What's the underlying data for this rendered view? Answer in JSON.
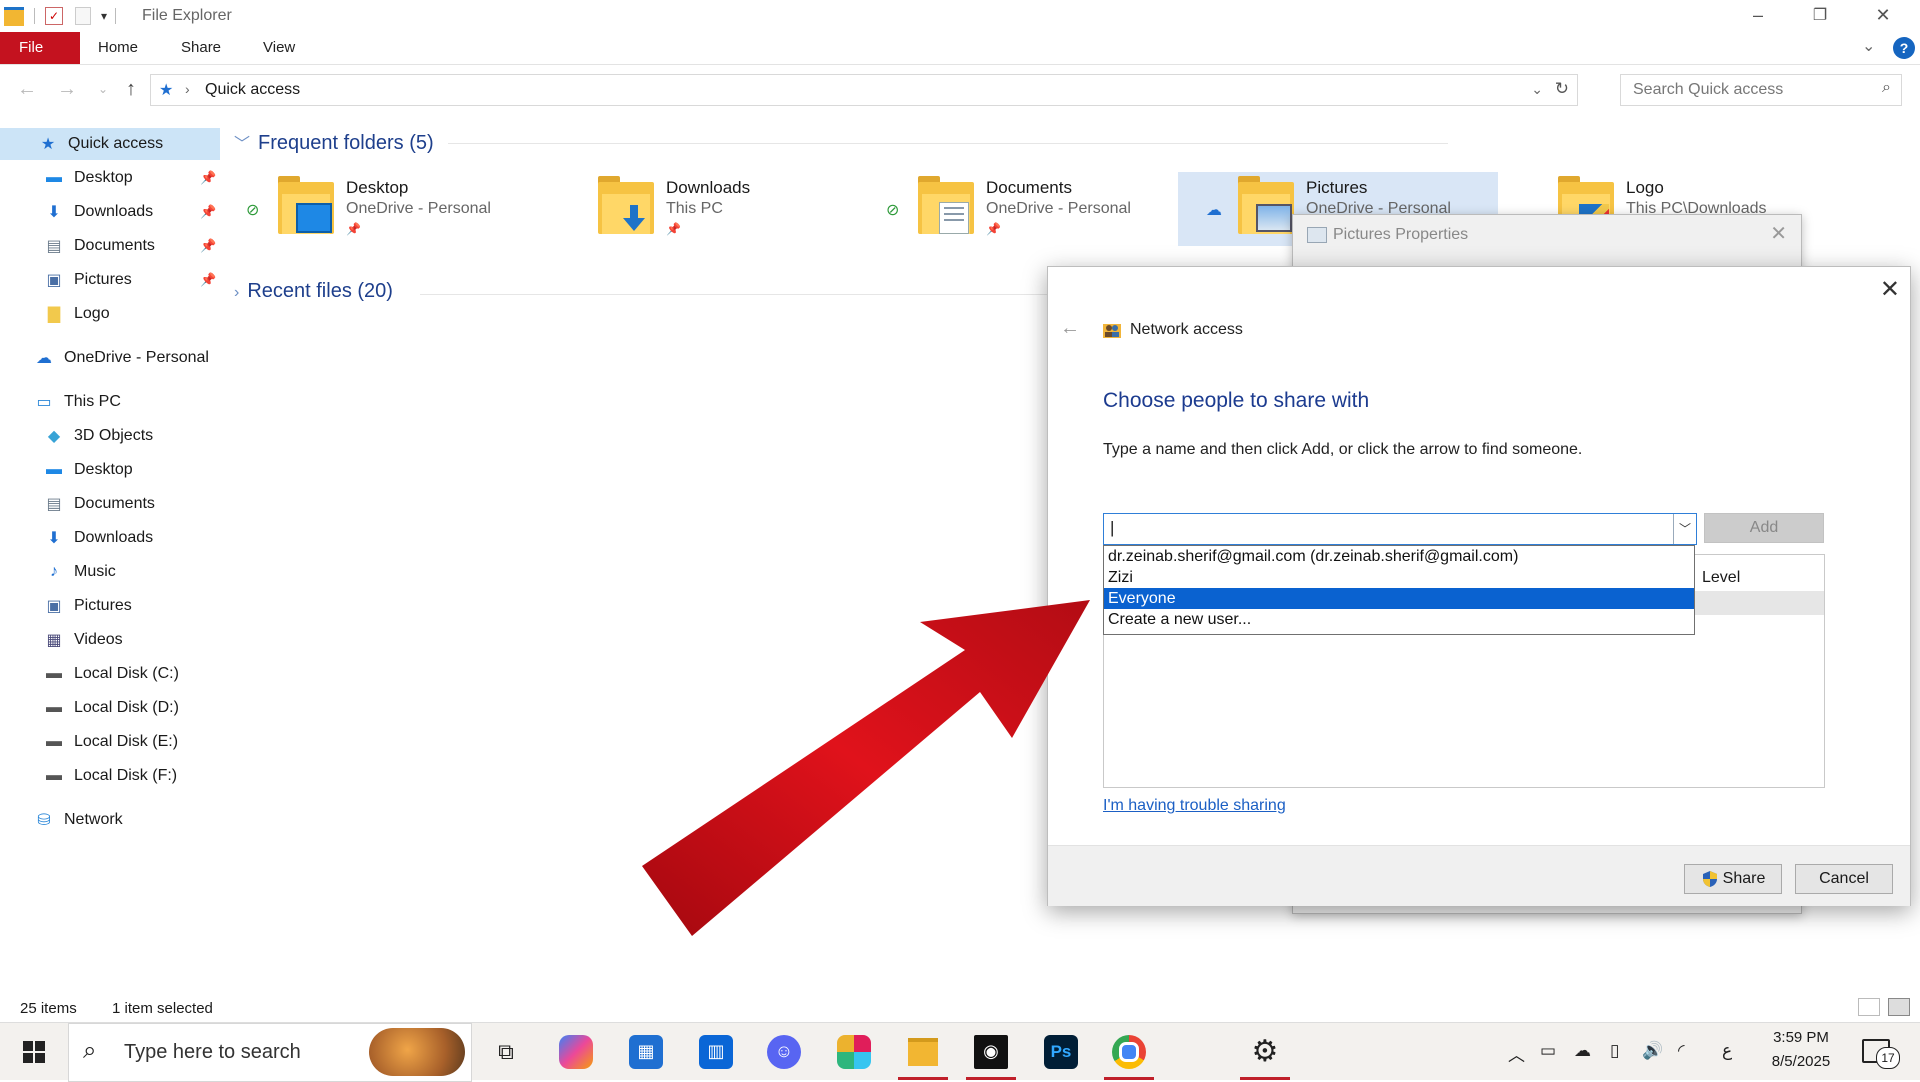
{
  "window": {
    "title": "File Explorer",
    "minimize": "–",
    "restore": "❐",
    "close": "✕"
  },
  "ribbon": {
    "tabs": [
      "File",
      "Home",
      "Share",
      "View"
    ],
    "expand": "⌄",
    "help": "?"
  },
  "address": {
    "path": "Quick access",
    "search_placeholder": "Search Quick access"
  },
  "sidebar": {
    "items": [
      {
        "label": "Quick access",
        "icon": "star-icon",
        "pinned": false
      },
      {
        "label": "Desktop",
        "icon": "desktop-icon",
        "pinned": true
      },
      {
        "label": "Downloads",
        "icon": "download-icon",
        "pinned": true
      },
      {
        "label": "Documents",
        "icon": "document-icon",
        "pinned": true
      },
      {
        "label": "Pictures",
        "icon": "pictures-icon",
        "pinned": true
      },
      {
        "label": "Logo",
        "icon": "folder-icon",
        "pinned": false
      },
      {
        "label": "OneDrive - Personal",
        "icon": "cloud-icon",
        "pinned": false
      },
      {
        "label": "This PC",
        "icon": "computer-icon",
        "pinned": false
      },
      {
        "label": "3D Objects",
        "icon": "cube-icon",
        "pinned": false
      },
      {
        "label": "Desktop",
        "icon": "desktop-icon",
        "pinned": false
      },
      {
        "label": "Documents",
        "icon": "document-icon",
        "pinned": false
      },
      {
        "label": "Downloads",
        "icon": "download-icon",
        "pinned": false
      },
      {
        "label": "Music",
        "icon": "music-icon",
        "pinned": false
      },
      {
        "label": "Pictures",
        "icon": "pictures-icon",
        "pinned": false
      },
      {
        "label": "Videos",
        "icon": "video-icon",
        "pinned": false
      },
      {
        "label": "Local Disk (C:)",
        "icon": "disk-icon",
        "pinned": false
      },
      {
        "label": "Local Disk (D:)",
        "icon": "disk-icon",
        "pinned": false
      },
      {
        "label": "Local Disk (E:)",
        "icon": "disk-icon",
        "pinned": false
      },
      {
        "label": "Local Disk (F:)",
        "icon": "disk-icon",
        "pinned": false
      },
      {
        "label": "Network",
        "icon": "network-icon",
        "pinned": false
      }
    ]
  },
  "content": {
    "frequent_header": "Frequent folders (5)",
    "recent_header": "Recent files (20)",
    "folders": [
      {
        "name": "Desktop",
        "location": "OneDrive - Personal",
        "status": "synced"
      },
      {
        "name": "Downloads",
        "location": "This PC",
        "status": "none"
      },
      {
        "name": "Documents",
        "location": "OneDrive - Personal",
        "status": "synced"
      },
      {
        "name": "Pictures",
        "location": "OneDrive - Personal",
        "status": "cloud"
      },
      {
        "name": "Logo",
        "location": "This PC\\Downloads",
        "status": "none"
      }
    ]
  },
  "properties_dialog": {
    "title": "Pictures Properties"
  },
  "share_dialog": {
    "header": "Network access",
    "heading": "Choose people to share with",
    "instruction": "Type a name and then click Add, or click the arrow to find someone.",
    "input_value": "",
    "add_label": "Add",
    "permission_header": "Level",
    "options": [
      "dr.zeinab.sherif@gmail.com (dr.zeinab.sherif@gmail.com)",
      "Zizi",
      "Everyone",
      "Create a new user..."
    ],
    "selected_option": "Everyone",
    "trouble_link": "I'm having trouble sharing",
    "share_label": "Share",
    "cancel_label": "Cancel"
  },
  "statusbar": {
    "items_count": "25 items",
    "selection": "1 item selected"
  },
  "taskbar": {
    "search_placeholder": "Type here to search",
    "time": "3:59 PM",
    "date": "8/5/2025",
    "notifications": "17",
    "lang": "ع"
  },
  "colors": {
    "accent": "#0a62d0",
    "file_tab": "#c4121f",
    "arrow": "#d9121a",
    "heading": "#1c3b8f"
  }
}
